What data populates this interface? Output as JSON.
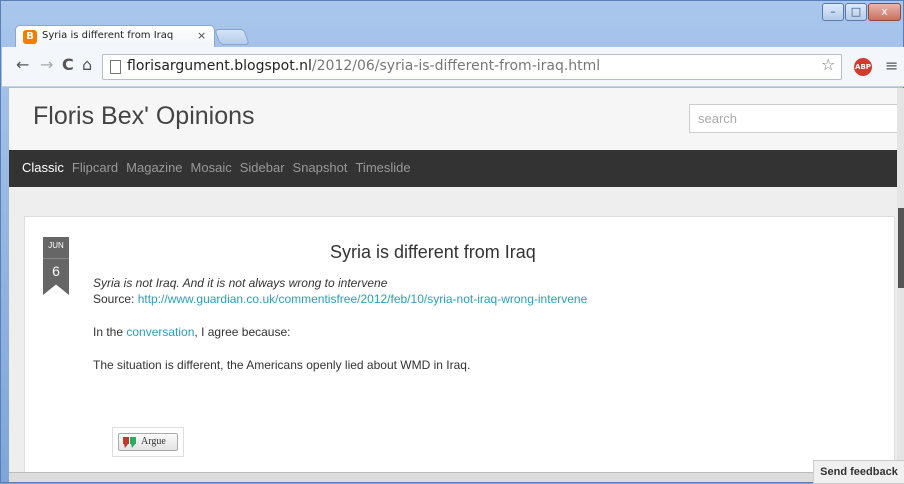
{
  "browser": {
    "tab_title": "Syria is different from Iraq",
    "tab_close": "×",
    "favicon_letter": "B",
    "url_host": "florisargument.blogspot.nl",
    "url_path": "/2012/06/syria-is-different-from-iraq.html",
    "window_controls": {
      "minimize": "–",
      "maximize": "□",
      "close": "x"
    },
    "abp_label": "ABP"
  },
  "site": {
    "title": "Floris Bex' Opinions",
    "search_placeholder": "search",
    "views": [
      "Classic",
      "Flipcard",
      "Magazine",
      "Mosaic",
      "Sidebar",
      "Snapshot",
      "Timeslide"
    ],
    "active_view": "Classic"
  },
  "post": {
    "date_month": "JUN",
    "date_day": "6",
    "title": "Syria is different from Iraq",
    "quote": "Syria is not Iraq. And it is not always wrong to intervene",
    "source_label": "Source: ",
    "source_url": "http://www.guardian.co.uk/commentisfree/2012/feb/10/syria-not-iraq-wrong-intervene",
    "intro_before": "In the ",
    "intro_link": "conversation",
    "intro_after": ", I agree because:",
    "body": "The situation is different, the Americans openly lied about WMD in Iraq.",
    "argue_label": "Argue"
  },
  "feedback_label": "Send feedback",
  "colors": {
    "link": "#2a9fb8",
    "viewbar": "#333333",
    "accent": "#f57d00"
  }
}
